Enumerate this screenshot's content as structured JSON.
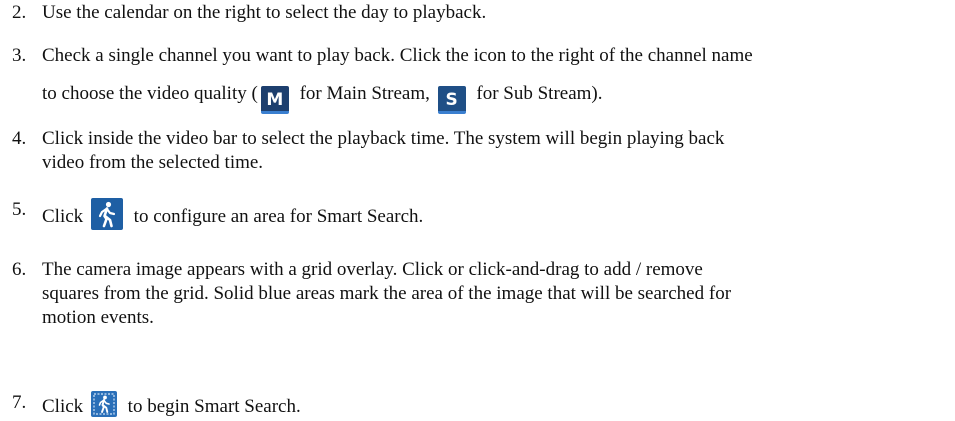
{
  "steps": [
    {
      "number": "2.",
      "lines": [
        [
          "Use the calendar on the right to select the day to playback."
        ]
      ]
    },
    {
      "number": "3.",
      "lines": [
        [
          "Check a single channel you want to play back. Click the icon to the right of the channel name"
        ],
        [
          "to choose the video quality (",
          " for Main Stream, ",
          " for Sub Stream)."
        ]
      ]
    },
    {
      "number": "4.",
      "lines": [
        [
          "Click inside the video bar to select the playback time. The system will begin playing back"
        ],
        [
          "video from the selected time."
        ]
      ]
    },
    {
      "number": "5.",
      "lines": [
        [
          "Click ",
          " to configure an area for Smart Search."
        ]
      ]
    },
    {
      "number": "6.",
      "lines": [
        [
          "The camera image appears with a grid overlay. Click or click-and-drag to add / remove"
        ],
        [
          "squares from the grid. Solid blue areas mark the area of the image that will be searched for"
        ],
        [
          "motion events."
        ]
      ]
    },
    {
      "number": "7.",
      "lines": [
        [
          "Click ",
          " to begin Smart Search."
        ]
      ]
    }
  ],
  "icons": {
    "main_stream": {
      "name": "main-stream-icon",
      "letter": "M",
      "color": "#1d3f6e"
    },
    "sub_stream": {
      "name": "sub-stream-icon",
      "letter": "S",
      "color": "#1f4f86"
    },
    "smart_search_area": {
      "name": "walking-person-icon",
      "color": "#1e5fa4"
    },
    "smart_search_start": {
      "name": "smart-search-icon",
      "color": "#2a6fb8"
    }
  }
}
